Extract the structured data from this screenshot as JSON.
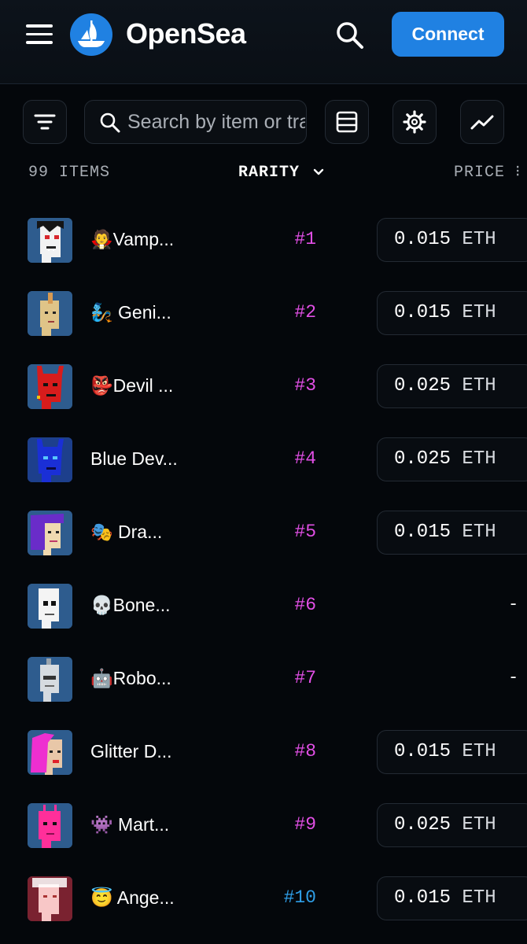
{
  "header": {
    "brand": "OpenSea",
    "connect_label": "Connect"
  },
  "toolbar": {
    "search_placeholder": "Search by item or trait"
  },
  "list_header": {
    "count": "99 ITEMS",
    "sort": "RARITY",
    "price": "PRICE"
  },
  "items": [
    {
      "name": "🧛Vamp...",
      "rank": "#1",
      "price": "0.015",
      "currency": "ETH"
    },
    {
      "name": "🧞 Geni...",
      "rank": "#2",
      "price": "0.015",
      "currency": "ETH"
    },
    {
      "name": "👺Devil ...",
      "rank": "#3",
      "price": "0.025",
      "currency": "ETH"
    },
    {
      "name": "Blue Dev...",
      "rank": "#4",
      "price": "0.025",
      "currency": "ETH"
    },
    {
      "name": "🎭 Dra...",
      "rank": "#5",
      "price": "0.015",
      "currency": "ETH"
    },
    {
      "name": "💀Bone...",
      "rank": "#6",
      "no_price": "-"
    },
    {
      "name": "🤖Robo...",
      "rank": "#7",
      "no_price": "-"
    },
    {
      "name": "Glitter D...",
      "rank": "#8",
      "price": "0.015",
      "currency": "ETH"
    },
    {
      "name": "👾 Mart...",
      "rank": "#9",
      "price": "0.025",
      "currency": "ETH"
    },
    {
      "name": "😇 Ange...",
      "rank": "#10",
      "price": "0.015",
      "currency": "ETH"
    }
  ],
  "colors": {
    "background": "#04070b",
    "accent": "#2081e2",
    "rank_pink": "#e24fe6",
    "rank_blue": "#2f9fe8"
  },
  "icons": [
    "menu-icon",
    "opensea-logo",
    "search-icon",
    "filter-icon",
    "list-view-icon",
    "settings-icon",
    "activity-chart-icon",
    "chevron-down-icon"
  ]
}
